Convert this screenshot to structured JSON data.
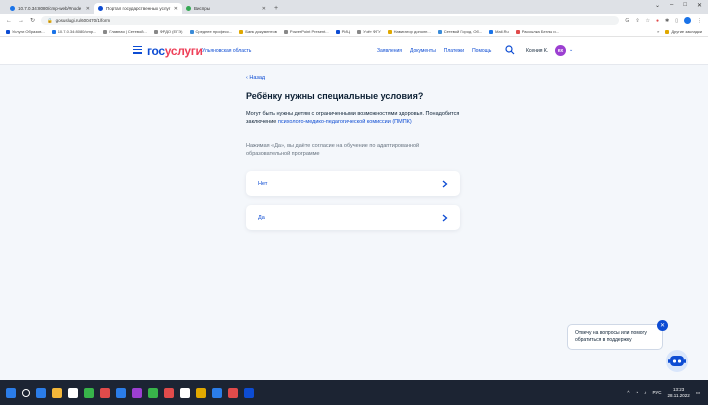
{
  "browser": {
    "tabs": [
      {
        "title": "10.7.0.34:8080/сmp-web/#node",
        "fav_color": "#1a73e8",
        "active": false
      },
      {
        "title": "Портал государственных услуг",
        "fav_color": "#0d4cd3",
        "active": true
      },
      {
        "title": "Виспры",
        "fav_color": "#34a853",
        "active": false
      }
    ],
    "new_tab": "+",
    "window_controls": [
      "⌄",
      "–",
      "□",
      "✕"
    ],
    "url": "gosuslugi.ru/600470/1/form",
    "bookmarks": [
      {
        "label": "Услуги Образов...",
        "color": "#0d4cd3"
      },
      {
        "label": "10.7.0.34:8080/cmp...",
        "color": "#1a73e8"
      },
      {
        "label": "Главная | Сетевой...",
        "color": "#888888"
      },
      {
        "label": "ФРДО (ЕГЭ)",
        "color": "#888888"
      },
      {
        "label": "Среднее професс...",
        "color": "#3a8bd8"
      },
      {
        "label": "Банк документов",
        "color": "#e0a800"
      },
      {
        "label": "PowerPoint Present...",
        "color": "#888888"
      },
      {
        "label": "РИЦ",
        "color": "#0d4cd3"
      },
      {
        "label": "Учёт ФГУ",
        "color": "#888888"
      },
      {
        "label": "Навигатор дополн...",
        "color": "#e0a800"
      },
      {
        "label": "Сетевой Город. Об...",
        "color": "#3a8bd8"
      },
      {
        "label": "Mail.Ru",
        "color": "#1a73e8"
      },
      {
        "label": "Рассылка Беглы и...",
        "color": "#e04b4b"
      }
    ],
    "bookmarks_other": "Другие закладки"
  },
  "header": {
    "logo_part1": "гос",
    "logo_part2": "услуги",
    "region": "Ульяновская область",
    "nav": [
      "Заявления",
      "Документы",
      "Платежи",
      "Помощь"
    ],
    "user_name": "Ксения К.",
    "avatar_initials": "КК"
  },
  "main": {
    "back_label": "‹ Назад",
    "title": "Ребёнку нужны специальные условия?",
    "desc_text": "Могут быть нужны детям с ограниченными возможностями здоровья. Понадобится заключение ",
    "desc_link": "психолого-медико-педагогической комиссии (ПМПК)",
    "consent": "Нажимая «Да», вы даёте согласие на обучение по адаптированной образовательной программе",
    "options": [
      {
        "label": "Нет"
      },
      {
        "label": "Да"
      }
    ]
  },
  "chat": {
    "text": "Отвечу на вопросы или помогу обратиться в поддержку",
    "close": "✕"
  },
  "taskbar": {
    "icons": [
      "#2b7de9",
      "#f3b73a",
      "#ffffff",
      "#38b44a",
      "#e04b4b",
      "#2b7de9",
      "#9c3fd1",
      "#38b44a",
      "#e04b4b",
      "#ffffff",
      "#e0a800",
      "#2b7de9",
      "#e04b4b",
      "#0d4cd3"
    ],
    "lang": "РУС",
    "time": "13:23",
    "date": "28.11.2022"
  },
  "colors": {
    "accent": "#0d4cd3",
    "brand_red": "#ee3f58",
    "page_bg": "#f4f7fb"
  }
}
